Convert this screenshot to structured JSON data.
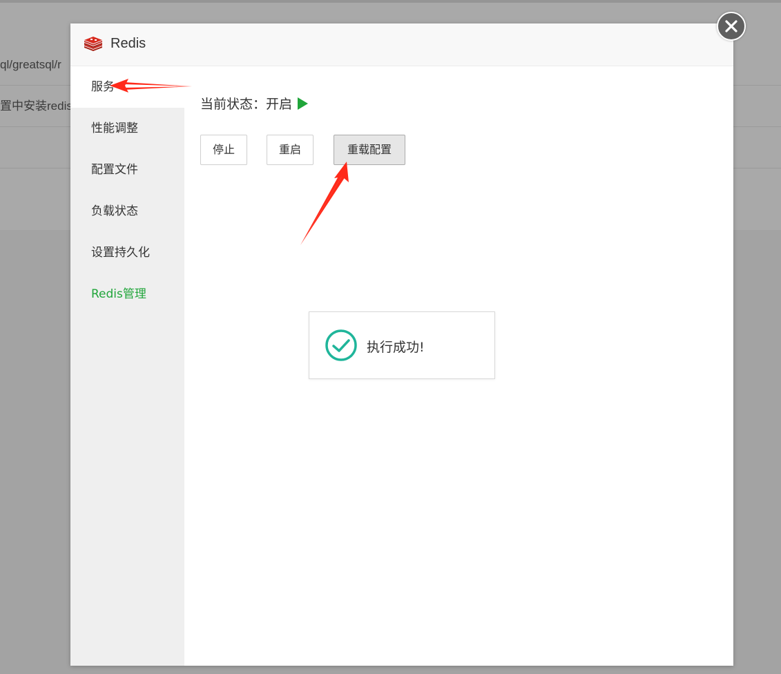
{
  "background": {
    "rows": [
      {
        "text": "ql/greatsql/r"
      },
      {
        "text": "置中安装redis"
      }
    ]
  },
  "dialog": {
    "title": "Redis",
    "logo_icon": "redis-logo-icon",
    "close_icon": "close-icon"
  },
  "sidebar": {
    "items": [
      {
        "label": "服务",
        "active": true
      },
      {
        "label": "性能调整"
      },
      {
        "label": "配置文件"
      },
      {
        "label": "负载状态"
      },
      {
        "label": "设置持久化"
      },
      {
        "label": "Redis管理",
        "accent": true
      }
    ]
  },
  "service": {
    "status_label": "当前状态：开启",
    "status_icon": "play-icon",
    "buttons": {
      "stop": "停止",
      "restart": "重启",
      "reload": "重载配置"
    }
  },
  "toast": {
    "message": "执行成功!",
    "icon": "check-circle-icon"
  },
  "colors": {
    "accent_green": "#20a53a",
    "toast_check": "#1fb59a",
    "annotation_red": "#ff2a1a"
  }
}
